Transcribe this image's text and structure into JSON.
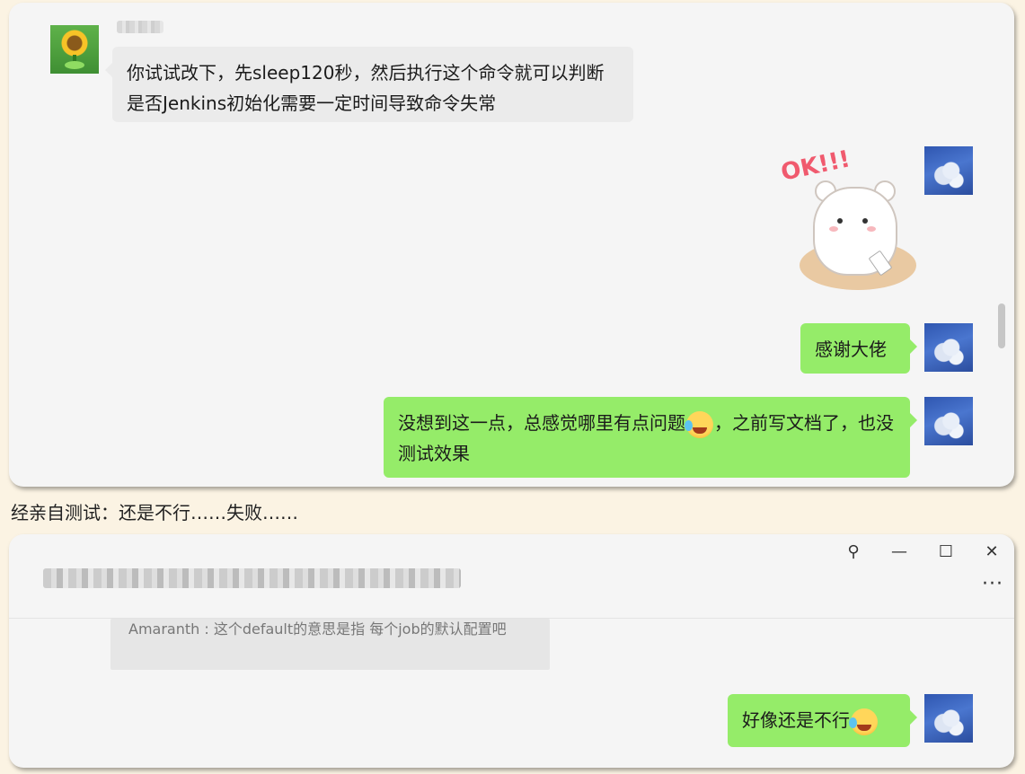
{
  "chat1": {
    "incoming_message": "你试试改下，先sleep120秒，然后执行这个命令就可以判断是否Jenkins初始化需要一定时间导致命令失常",
    "sticker_text": "OK!!!",
    "reply_thanks": "感谢大佬",
    "reply_long_part1": "没想到这一点，总感觉哪里有点问题",
    "reply_long_part2": "，之前写文档了，也没测试效果",
    "emoji_name": "laughing-crying-emoji"
  },
  "caption": "经亲自测试：还是不行……失败……",
  "chat2": {
    "window_buttons": {
      "pin": "⚲",
      "minimize": "—",
      "maximize": "☐",
      "close": "✕"
    },
    "more_label": "···",
    "quoted_message": "Amaranth : 这个default的意思是指 每个job的默认配置吧",
    "reply": "好像还是不行"
  },
  "colors": {
    "page_background": "#fbf3e3",
    "card_background": "#f5f5f5",
    "incoming_bubble": "#ebebeb",
    "outgoing_bubble": "#95ec69"
  }
}
